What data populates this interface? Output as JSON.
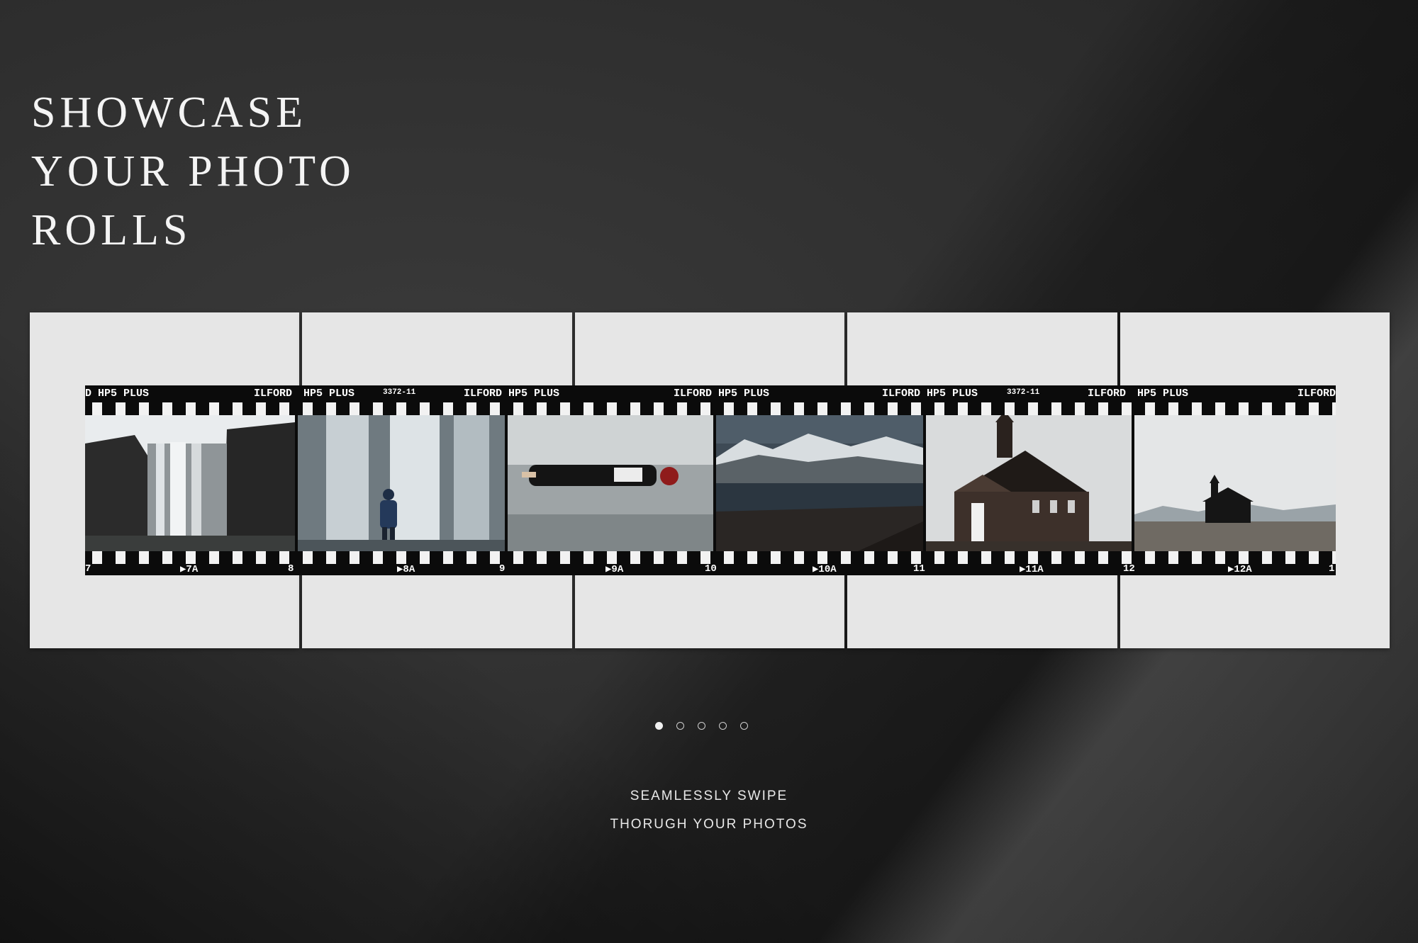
{
  "headline": {
    "lines": [
      "SHOWCASE",
      "YOUR PHOTO",
      "ROLLS"
    ]
  },
  "film": {
    "brand_labels": [
      "D HP5 PLUS",
      "ILFORD",
      "HP5 PLUS",
      "ILFORD HP5 PLUS",
      "ILFORD HP5 PLUS",
      "ILFORD HP5 PLUS",
      "ILFORD",
      "HP5 PLUS",
      "ILFORD"
    ],
    "code_labels": [
      "3372-11",
      "3372-11"
    ],
    "frame_numbers": [
      "7",
      "▶7A",
      "8",
      "▶8A",
      "9",
      "▶9A",
      "10",
      "▶10A",
      "11",
      "▶11A",
      "12",
      "▶12A",
      "1"
    ],
    "frames": [
      {
        "name": "waterfall-cliff-photo"
      },
      {
        "name": "person-at-waterfall-photo"
      },
      {
        "name": "person-lying-on-beach-photo"
      },
      {
        "name": "snowy-mountains-lake-photo"
      },
      {
        "name": "black-church-closeup-photo"
      },
      {
        "name": "black-church-distant-photo"
      }
    ]
  },
  "carousel": {
    "page_count": 5,
    "active_index": 0
  },
  "caption": {
    "line1": "SEAMLESSLY SWIPE",
    "line2": "THORUGH YOUR PHOTOS"
  }
}
